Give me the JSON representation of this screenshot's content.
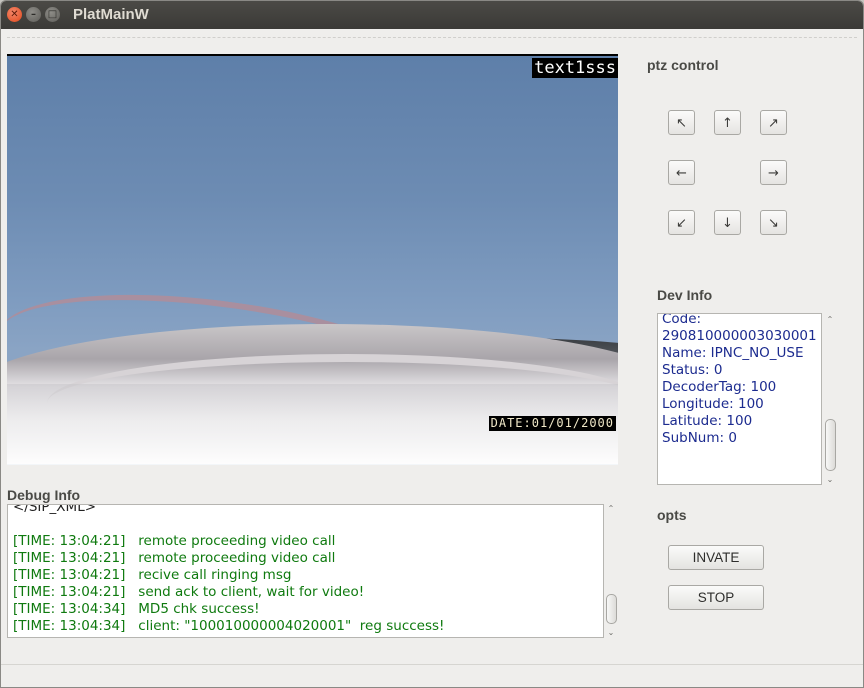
{
  "window": {
    "title": "PlatMainW",
    "close_glyph": "✕",
    "min_glyph": "–",
    "max_glyph": "□"
  },
  "video": {
    "osd_text": "text1sss",
    "osd_date": "DATE:01/01/2000"
  },
  "ptz": {
    "label": "ptz control",
    "buttons": {
      "up_left": "↖",
      "up": "↑",
      "up_right": "↗",
      "left": "←",
      "right": "→",
      "down_left": "↙",
      "down": "↓",
      "down_right": "↘"
    }
  },
  "dev_info": {
    "label": "Dev Info",
    "lines": [
      "Code:",
      "290810000003030001",
      "Name: IPNC_NO_USE",
      "Status: 0",
      "DecoderTag: 100",
      "Longitude: 100",
      "Latitude: 100",
      "SubNum: 0"
    ]
  },
  "debug": {
    "label": "Debug Info",
    "lines": [
      {
        "text": "</SIP_XML>",
        "style": "plain"
      },
      {
        "text": "",
        "style": "plain"
      },
      {
        "text": "[TIME: 13:04:21]   remote proceeding video call",
        "style": "ok"
      },
      {
        "text": "[TIME: 13:04:21]   remote proceeding video call",
        "style": "ok"
      },
      {
        "text": "[TIME: 13:04:21]   recive call ringing msg",
        "style": "ok"
      },
      {
        "text": "[TIME: 13:04:21]   send ack to client, wait for video!",
        "style": "ok"
      },
      {
        "text": "[TIME: 13:04:34]   MD5 chk success!",
        "style": "ok"
      },
      {
        "text": "[TIME: 13:04:34]   client: \"100010000004020001\"  reg success!",
        "style": "ok"
      }
    ]
  },
  "opts": {
    "label": "opts",
    "invate_label": "INVATE",
    "stop_label": "STOP"
  },
  "scroll": {
    "up_glyph": "⌃",
    "down_glyph": "⌄"
  }
}
